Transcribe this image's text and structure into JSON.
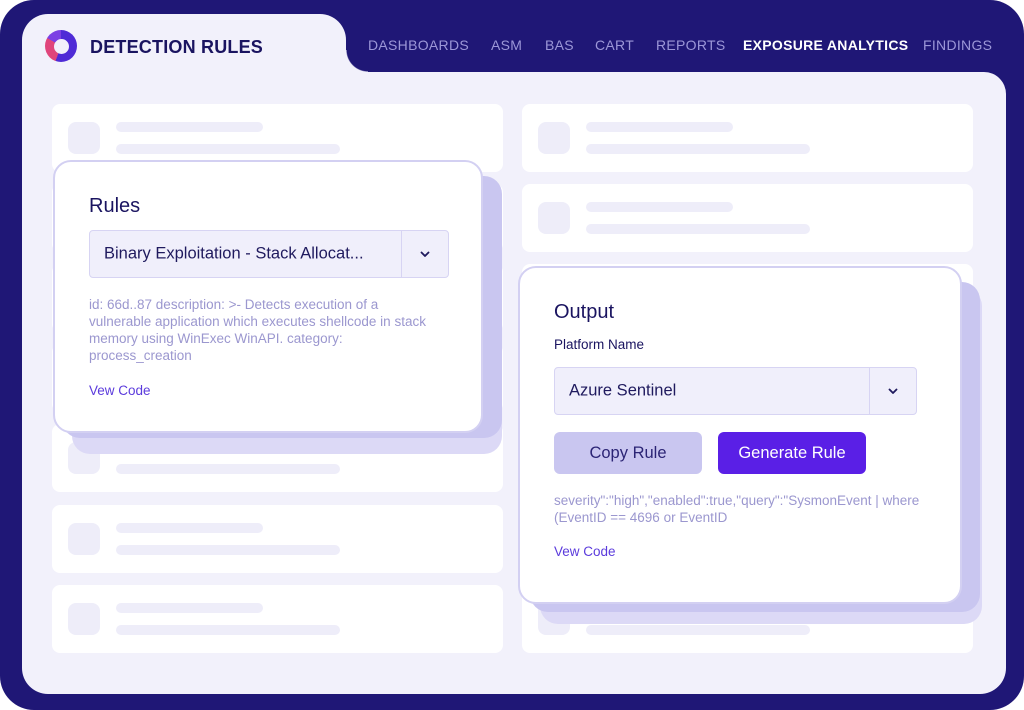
{
  "header": {
    "app_title": "DETECTION RULES",
    "nav": [
      {
        "label": "DASHBOARDS",
        "active": false
      },
      {
        "label": "ASM",
        "active": false
      },
      {
        "label": "BAS",
        "active": false
      },
      {
        "label": "CART",
        "active": false
      },
      {
        "label": "REPORTS",
        "active": false
      },
      {
        "label": "EXPOSURE ANALYTICS",
        "active": true
      },
      {
        "label": "FINDINGS",
        "active": false
      }
    ]
  },
  "rules_card": {
    "title": "Rules",
    "selected_rule": "Binary Exploitation - Stack Allocat...",
    "description": "id: 66d..87 description: >- Detects execution of a vulnerable application which executes shellcode in stack memory using WinExec WinAPI. category: process_creation",
    "view_code_label": "Vew Code"
  },
  "output_card": {
    "title": "Output",
    "platform_label": "Platform Name",
    "platform_value": "Azure Sentinel",
    "copy_button": "Copy Rule",
    "generate_button": "Generate Rule",
    "output_text": "severity\":\"high\",\"enabled\":true,\"query\":\"SysmonEvent | where (EventID == 4696 or EventID",
    "view_code_label": "Vew Code"
  },
  "icons": {
    "logo": "ring-logo-icon",
    "dropdown": "chevron-down-icon"
  },
  "colors": {
    "frame": "#1f1776",
    "canvas": "#f2f1fb",
    "accent": "#5a1fe6",
    "text_dark": "#1a1460",
    "text_muted": "#9b97cf"
  }
}
